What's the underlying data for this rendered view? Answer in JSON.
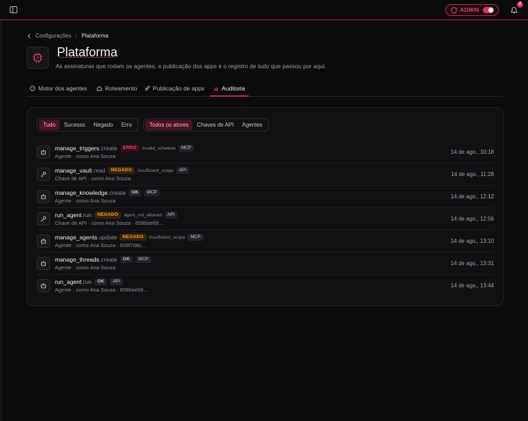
{
  "topbar": {
    "admin_label": "ADMIN",
    "notification_count": "2",
    "accent": "#c4254a"
  },
  "breadcrumb": {
    "parent": "Configurações",
    "separator": "›",
    "current": "Plataforma"
  },
  "page": {
    "title": "Plataforma",
    "subtitle": "As assinaturas que rodam os agentes, a publicação dos apps e o registro de tudo que passou por aqui."
  },
  "tabs": [
    {
      "label": "Motor dos agentes",
      "icon": "gauge-icon"
    },
    {
      "label": "Roteamento",
      "icon": "home-icon"
    },
    {
      "label": "Publicação de apps",
      "icon": "rocket-icon"
    },
    {
      "label": "Auditoria",
      "icon": "bar-chart-icon",
      "active": true
    }
  ],
  "filters": {
    "status": [
      "Tudo",
      "Sucesso",
      "Negado",
      "Erro"
    ],
    "status_active": "Tudo",
    "actors": [
      "Todos os atores",
      "Chaves de API",
      "Agentes"
    ],
    "actors_active": "Todos os atores"
  },
  "events": [
    {
      "icon": "bot-icon",
      "op": "manage_triggers",
      "verb": ".create",
      "status": "ERRO",
      "status_kind": "erro",
      "reason": "invalid_schedule",
      "channel": "MCP",
      "actor": "Agente · como Ana Souza",
      "time": "14 de ago., 10:18"
    },
    {
      "icon": "key-icon",
      "op": "manage_vault",
      "verb": ".read",
      "status": "NEGADO",
      "status_kind": "negado",
      "reason": "insufficient_scope",
      "channel": "API",
      "actor": "Chave de API · como Ana Souza",
      "time": "14 de ago., 11:28"
    },
    {
      "icon": "bot-icon",
      "op": "manage_knowledge",
      "verb": ".create",
      "status": "OK",
      "status_kind": "ok",
      "reason": "",
      "channel": "MCP",
      "actor": "Agente · como Ana Souza",
      "time": "14 de ago., 12:12"
    },
    {
      "icon": "key-icon",
      "op": "run_agent",
      "verb": ".run",
      "status": "NEGADO",
      "status_kind": "negado",
      "reason": "agent_not_allowed",
      "channel": "API",
      "actor": "Chave de API · como Ana Souza · 8586ae69...",
      "time": "14 de ago., 12:56"
    },
    {
      "icon": "bot-icon",
      "op": "manage_agents",
      "verb": ".update",
      "status": "NEGADO",
      "status_kind": "negado",
      "reason": "insufficient_scope",
      "channel": "MCP",
      "actor": "Agente · como Ana Souza · 609f7d8c...",
      "time": "14 de ago., 13:10"
    },
    {
      "icon": "bot-icon",
      "op": "manage_threads",
      "verb": ".create",
      "status": "OK",
      "status_kind": "ok",
      "reason": "",
      "channel": "MCP",
      "actor": "Agente · como Ana Souza",
      "time": "14 de ago., 13:31"
    },
    {
      "icon": "bot-icon",
      "op": "run_agent",
      "verb": ".run",
      "status": "OK",
      "status_kind": "ok",
      "reason": "",
      "channel": "API",
      "actor": "Agente · como Ana Souza · 8586ae69...",
      "time": "14 de ago., 13:44"
    }
  ]
}
